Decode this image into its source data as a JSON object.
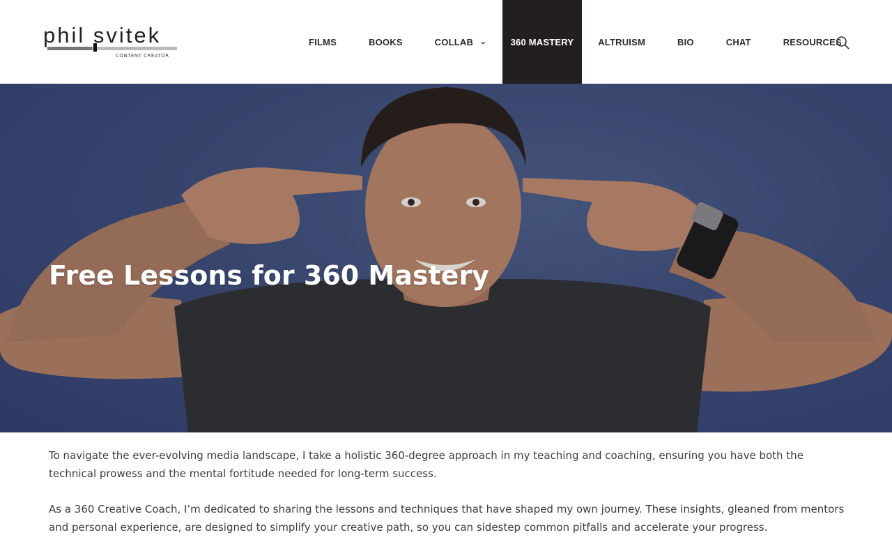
{
  "logo": {
    "name": "phil svitek",
    "tagline": "CONTENT CREATOR"
  },
  "nav": {
    "items": [
      {
        "label": "FILMS"
      },
      {
        "label": "BOOKS"
      },
      {
        "label": "COLLAB",
        "dropdown": true
      },
      {
        "label": "360 MASTERY",
        "active": true
      },
      {
        "label": "ALTRUISM"
      },
      {
        "label": "BIO"
      },
      {
        "label": "CHAT"
      },
      {
        "label": "RESOURCES"
      }
    ],
    "search_icon": "search-icon"
  },
  "hero": {
    "title": "Free Lessons for 360 Mastery"
  },
  "content": {
    "paragraphs": [
      "To navigate the ever-evolving media landscape, I take a holistic 360-degree approach in my teaching and coaching, ensuring you have both the technical prowess and the mental fortitude needed for long-term success.",
      "As a 360 Creative Coach, I’m dedicated to sharing the lessons and techniques that have shaped my own journey. These insights, gleaned from mentors and personal experience, are designed to simplify your creative path, so you can sidestep common pitfalls and accelerate your progress."
    ]
  },
  "colors": {
    "active_nav_bg": "#231f20",
    "hero_bg": "#3f4f7d",
    "text": "#3d3d3d"
  }
}
